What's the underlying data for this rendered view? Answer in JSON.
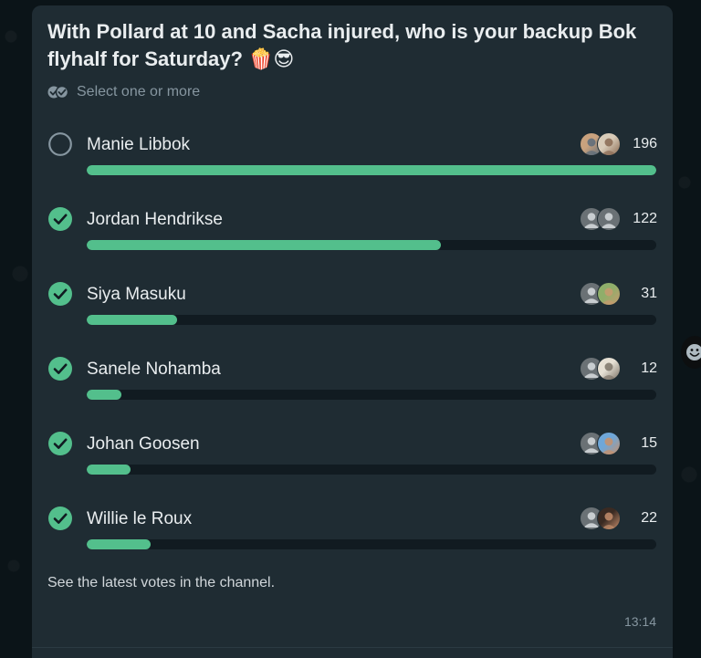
{
  "poll": {
    "question": "With Pollard at 10 and Sacha injured, who is your backup Bok flyhalf for Saturday? 🍿😎",
    "select_hint": "Select one or more",
    "footer_note": "See the latest votes in the channel.",
    "timestamp": "13:14",
    "max_votes": 196,
    "options": [
      {
        "name": "Manie Libbok",
        "count": "196",
        "votes": 196,
        "checked": false,
        "avatars": [
          {
            "kind": "photo",
            "c1": "#c9a27e",
            "c2": "#5a6b7a"
          },
          {
            "kind": "photo",
            "c1": "#d8cbb8",
            "c2": "#8a6a52"
          }
        ]
      },
      {
        "name": "Jordan Hendrikse",
        "count": "122",
        "votes": 122,
        "checked": true,
        "avatars": [
          {
            "kind": "generic"
          },
          {
            "kind": "generic"
          }
        ]
      },
      {
        "name": "Siya Masuku",
        "count": "31",
        "votes": 31,
        "checked": true,
        "avatars": [
          {
            "kind": "generic"
          },
          {
            "kind": "photo",
            "c1": "#8fae6a",
            "c2": "#c89a6e"
          }
        ]
      },
      {
        "name": "Sanele Nohamba",
        "count": "12",
        "votes": 12,
        "checked": true,
        "avatars": [
          {
            "kind": "generic"
          },
          {
            "kind": "photo",
            "c1": "#e6e0d4",
            "c2": "#7d7468"
          }
        ]
      },
      {
        "name": "Johan Goosen",
        "count": "15",
        "votes": 15,
        "checked": true,
        "avatars": [
          {
            "kind": "generic"
          },
          {
            "kind": "photo",
            "c1": "#6fa7d8",
            "c2": "#c9906a"
          }
        ]
      },
      {
        "name": "Willie le Roux",
        "count": "22",
        "votes": 22,
        "checked": true,
        "avatars": [
          {
            "kind": "generic"
          },
          {
            "kind": "photo",
            "c1": "#3a2a22",
            "c2": "#c58e6c"
          }
        ]
      }
    ]
  },
  "colors": {
    "accent": "#53bf8c",
    "card_bg": "#1f2c33",
    "track_bg": "#111b21",
    "text_primary": "#e9edef",
    "text_secondary": "#8696a0"
  },
  "icons": {
    "select_hint": "double-check-icon",
    "checked": "check-circle-icon",
    "unchecked": "empty-circle-icon",
    "react": "emoji-smile-icon"
  }
}
